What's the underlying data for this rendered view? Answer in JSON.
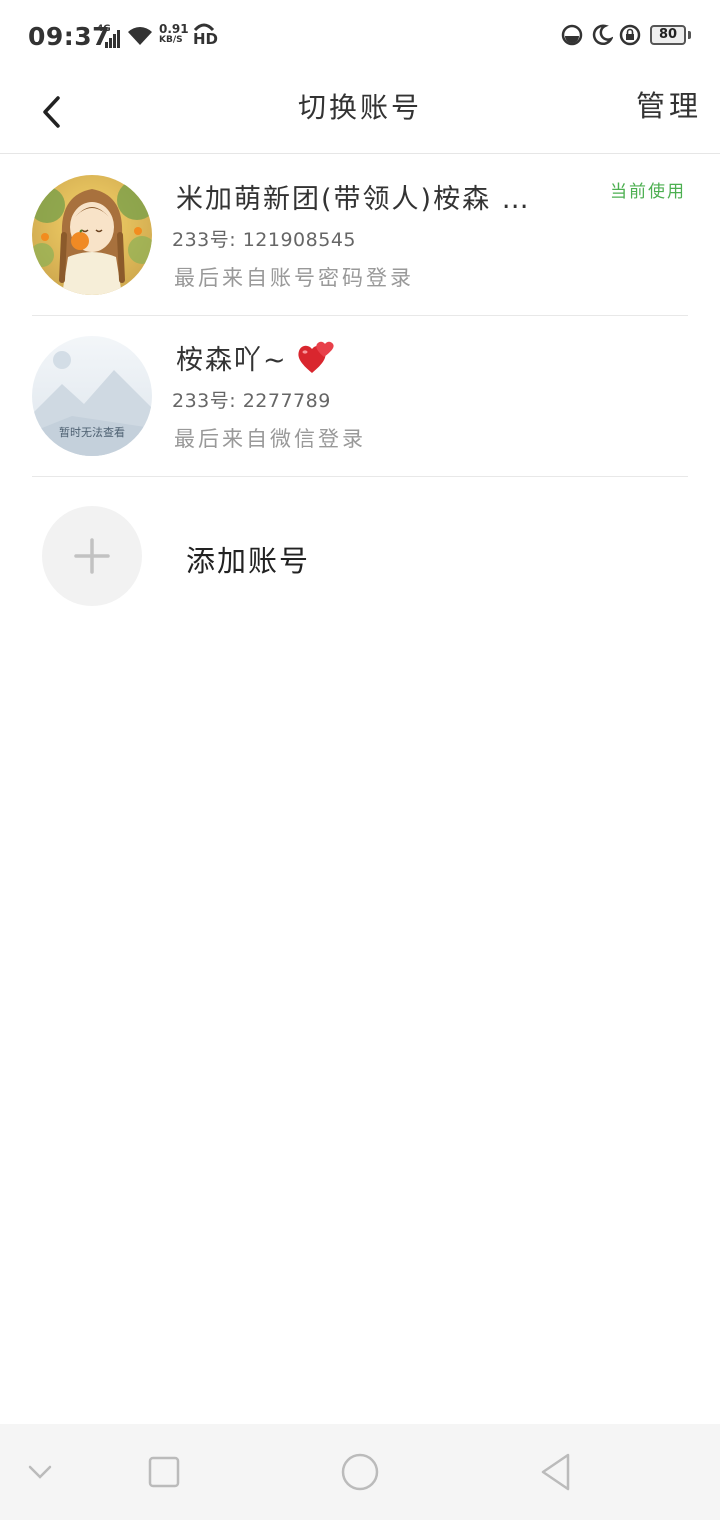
{
  "status_bar": {
    "time": "09:37",
    "network": "4G",
    "speed_value": "0.91",
    "speed_unit": "KB/S",
    "hd": "HD",
    "battery": "80"
  },
  "header": {
    "title": "切换账号",
    "manage_label": "管理"
  },
  "accounts": [
    {
      "name": "米加萌新团(带领人)桉森 …",
      "uid": "233号: 121908545",
      "login": "最后来自账号密码登录",
      "badge": "当前使用"
    },
    {
      "name": "桉森吖~",
      "uid": "233号: 2277789",
      "login": "最后来自微信登录",
      "avatar_text": "暂时无法查看"
    }
  ],
  "add_account": {
    "label": "添加账号"
  },
  "colors": {
    "badge_green": "#4caf50",
    "divider": "#e8e8e8",
    "navbar_bg": "#f5f5f5"
  },
  "icons": [
    "back-arrow-icon",
    "heart-emoji-icon",
    "plus-icon",
    "chevron-down-icon",
    "square-recents-icon",
    "circle-home-icon",
    "triangle-back-icon"
  ]
}
